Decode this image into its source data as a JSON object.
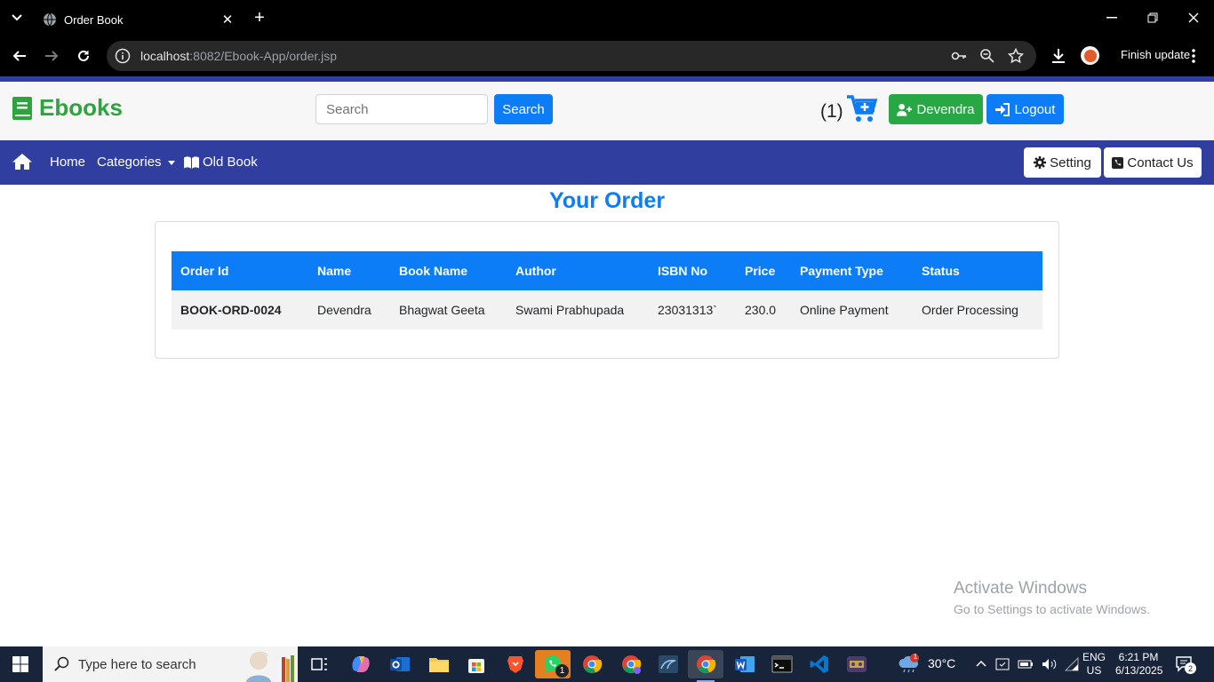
{
  "browser": {
    "tab_title": "Order Book",
    "url_host": "localhost",
    "url_rest": ":8082/Ebook-App/order.jsp",
    "finish_update_label": "Finish update"
  },
  "header": {
    "brand": "Ebooks",
    "search_placeholder": "Search",
    "search_button": "Search",
    "cart_count": "(1)",
    "user_button": "Devendra",
    "logout_button": "Logout"
  },
  "navbar": {
    "home": "Home",
    "categories": "Categories",
    "old_book": "Old Book",
    "setting": "Setting",
    "contact": "Contact Us"
  },
  "orders": {
    "title": "Your Order",
    "columns": [
      "Order Id",
      "Name",
      "Book Name",
      "Author",
      "ISBN No",
      "Price",
      "Payment Type",
      "Status"
    ],
    "rows": [
      [
        "BOOK-ORD-0024",
        "Devendra",
        "Bhagwat Geeta",
        "Swami Prabhupada",
        "23031313`",
        "230.0",
        "Online Payment",
        "Order Processing"
      ]
    ]
  },
  "watermark": {
    "line1": "Activate Windows",
    "line2": "Go to Settings to activate Windows."
  },
  "taskbar": {
    "search_placeholder": "Type here to search",
    "whatsapp_badge": "1",
    "weather_badge": "1",
    "temperature": "30°C",
    "lang_line1": "ENG",
    "lang_line2": "US",
    "time": "6:21 PM",
    "date": "6/13/2025",
    "notification_count": "2"
  },
  "colors": {
    "primary": "#0d7df7",
    "success": "#28a745",
    "navbar": "#303f9f",
    "brand": "#2ea43f"
  }
}
